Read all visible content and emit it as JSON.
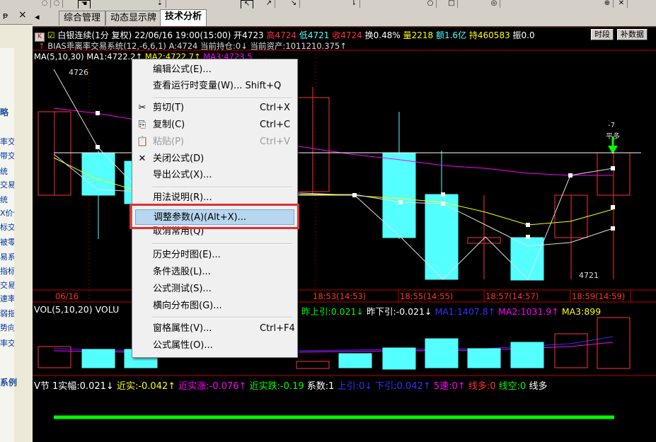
{
  "toolbar": {
    "icons": [
      "refresh-icon",
      "camera-icon",
      "hand-icon",
      "arrow-icon",
      "cursor-icon",
      "pencil-icon",
      "zoom-icon",
      "print-icon",
      "circle-icon",
      "square-icon",
      "settings-icon",
      "pin-icon",
      "close-icon"
    ]
  },
  "leftpanel": {
    "header": {
      "pin": "ᵽ",
      "close": "×"
    },
    "strategy_label": "略",
    "items": [
      "率交",
      "带交",
      "统",
      "交易",
      "统",
      "X价位",
      "标交",
      "被零",
      "易系",
      "指标",
      "交易",
      "速率",
      "弱指",
      "势向",
      "率交"
    ],
    "example_label": "系例"
  },
  "tabs": [
    {
      "label": "综合管理",
      "active": false
    },
    {
      "label": "动态显示牌",
      "active": false
    },
    {
      "label": "技术分析",
      "active": true
    }
  ],
  "quote": {
    "name": "白银连续(1分 复权)",
    "date": "22/06/16 19:00(15:00)",
    "open": "开4723",
    "high": "高4724",
    "low": "低4721",
    "close": "收4724",
    "change": "换0.48%",
    "volume": "量2218",
    "amount": "额1.6亿",
    "position": "持460583",
    "amplitude": "振0.0",
    "btn_time": "时段",
    "btn_fill": "补数据"
  },
  "system_line": "BIAS乖离率交易系统(12,-6,6,1) A:4724 当前持仓:0↓ 当前资产:1011210.375↑",
  "ma_line": {
    "label": "MA(5,10,30) MA1:4722.2↑",
    "ma2": "MA2:4722.7↑",
    "ma3": "MA3:4723.5"
  },
  "price_labels": {
    "high": "4726",
    "low": "4721",
    "signal": "-7",
    "signal_text": "平多"
  },
  "time_axis": [
    "06/16",
    "18:53(14:53)",
    "18:55(14:55)",
    "18:57(14:57)",
    "18:59(14:59)"
  ],
  "vol_line": {
    "label": "VOL(5,10,20) VOLU",
    "prev_up": "昨上引:0.021↓",
    "prev_down": "昨下引:-0.021↓",
    "ma1": "MA1:1407.8↑",
    "ma2": "MA2:1031.9↑",
    "ma3": "MA3:899"
  },
  "v_line": {
    "a": "V节 1实幅:0.021↓",
    "b": "近实:-0.042↑",
    "c": "近实涨:-0.076↑",
    "d": "近实跌:-0.19",
    "e": "系数:1",
    "f": "上引:0↓",
    "g": "下引:0.042↑",
    "h": "5速:0↑",
    "i": "线多:0",
    "j": "线空:0",
    "k": "线多"
  },
  "colors": {
    "up": "#ff3232",
    "down": "#54ffff",
    "ma1": "#ffffff",
    "ma2": "#ffff00",
    "ma3": "#ff00ff",
    "green": "#00ff00",
    "yellow": "#ffff00",
    "blue": "#3232ff"
  },
  "menu": {
    "items": [
      {
        "label": "编辑公式(E)...",
        "shortcut": "",
        "icon": "",
        "disabled": false,
        "hl": false
      },
      {
        "label": "查看运行时变量(W)... Shift+Q",
        "shortcut": "",
        "icon": "",
        "disabled": false,
        "hl": false
      },
      {
        "label": "剪切(T)",
        "shortcut": "Ctrl+X",
        "icon": "✂",
        "disabled": false,
        "hl": false
      },
      {
        "label": "复制(C)",
        "shortcut": "Ctrl+C",
        "icon": "⎘",
        "disabled": false,
        "hl": false
      },
      {
        "label": "粘贴(P)",
        "shortcut": "Ctrl+V",
        "icon": "📋",
        "disabled": true,
        "hl": false
      },
      {
        "label": "关闭公式(D)",
        "shortcut": "",
        "icon": "✕",
        "disabled": false,
        "hl": false
      },
      {
        "label": "导出公式(X)...",
        "shortcut": "",
        "icon": "",
        "disabled": false,
        "hl": false
      },
      {
        "label": "用法说明(R)...",
        "shortcut": "",
        "icon": "",
        "disabled": false,
        "hl": false
      },
      {
        "label": "调整参数(A)(Alt+X)...",
        "shortcut": "",
        "icon": "",
        "disabled": false,
        "hl": true
      },
      {
        "label": "取消常用(Q)",
        "shortcut": "",
        "icon": "",
        "disabled": false,
        "hl": false
      },
      {
        "label": "历史分时图(E)...",
        "shortcut": "",
        "icon": "",
        "disabled": false,
        "hl": false
      },
      {
        "label": "条件选股(L)...",
        "shortcut": "",
        "icon": "",
        "disabled": false,
        "hl": false
      },
      {
        "label": "公式测试(S)...",
        "shortcut": "",
        "icon": "",
        "disabled": false,
        "hl": false
      },
      {
        "label": "横向分布图(G)...",
        "shortcut": "",
        "icon": "",
        "disabled": false,
        "hl": false
      },
      {
        "label": "窗格属性(V)...",
        "shortcut": "Ctrl+F4",
        "icon": "",
        "disabled": false,
        "hl": false
      },
      {
        "label": "公式属性(O)...",
        "shortcut": "",
        "icon": "",
        "disabled": false,
        "hl": false
      }
    ]
  }
}
